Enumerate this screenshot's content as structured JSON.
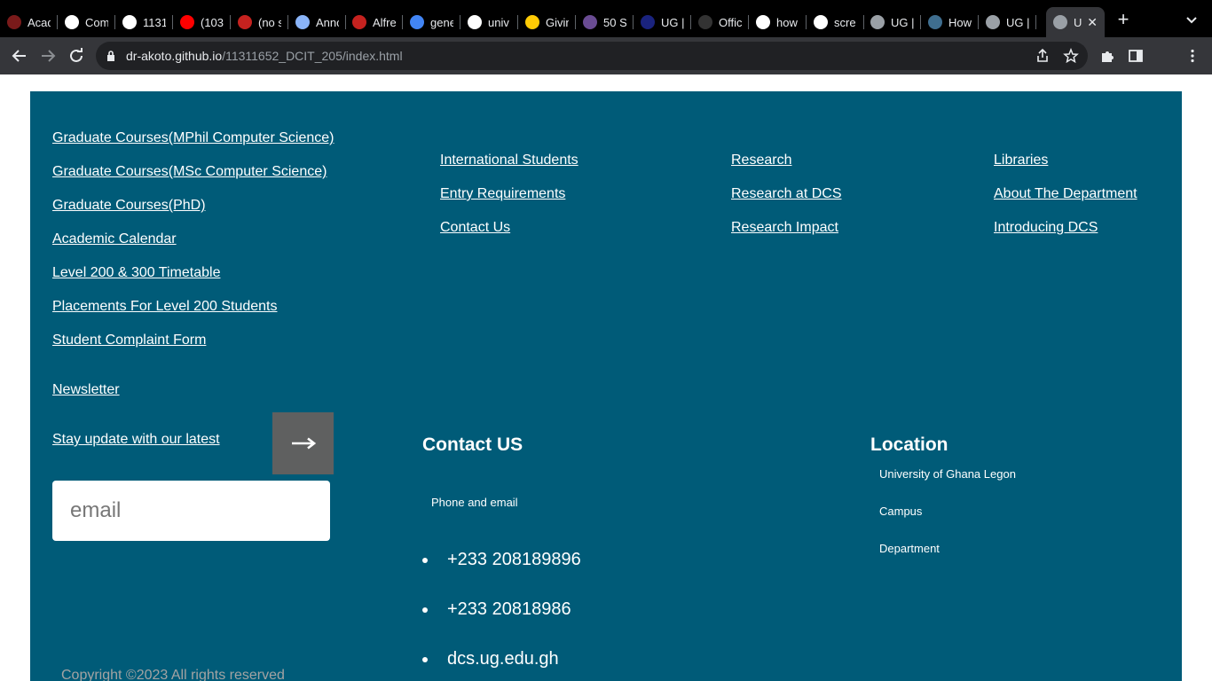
{
  "browser": {
    "tabs": [
      {
        "title": "Acad",
        "favicon": "red-dot-icon",
        "color": "#7a1a1a"
      },
      {
        "title": "Com",
        "favicon": "github-icon",
        "color": "#ffffff"
      },
      {
        "title": "1131",
        "favicon": "github-icon",
        "color": "#ffffff"
      },
      {
        "title": "(103",
        "favicon": "youtube-icon",
        "color": "#ff0000"
      },
      {
        "title": "(no s",
        "favicon": "gmail-icon",
        "color": "#c5221f"
      },
      {
        "title": "Anno",
        "favicon": "doc-icon",
        "color": "#8ab4f8"
      },
      {
        "title": "Alfre",
        "favicon": "gmail-icon",
        "color": "#c5221f"
      },
      {
        "title": "gene",
        "favicon": "search-icon",
        "color": "#4285f4"
      },
      {
        "title": "univ",
        "favicon": "google-icon",
        "color": "#ffffff"
      },
      {
        "title": "Givin",
        "favicon": "michigan-icon",
        "color": "#ffcb05"
      },
      {
        "title": "50 S",
        "favicon": "crest-icon",
        "color": "#6a4c93"
      },
      {
        "title": "UG |",
        "favicon": "ug-icon",
        "color": "#1a237e"
      },
      {
        "title": "Offic",
        "favicon": "github-icon",
        "color": "#333333"
      },
      {
        "title": "how",
        "favicon": "google-icon",
        "color": "#ffffff"
      },
      {
        "title": "scre",
        "favicon": "google-icon",
        "color": "#ffffff"
      },
      {
        "title": "UG |",
        "favicon": "globe-icon",
        "color": "#9aa0a6"
      },
      {
        "title": "How",
        "favicon": "box-icon",
        "color": "#3f6e8f"
      },
      {
        "title": "UG |",
        "favicon": "globe-icon",
        "color": "#9aa0a6"
      },
      {
        "title": "U",
        "favicon": "globe-icon",
        "color": "#9aa0a6",
        "active": true
      }
    ],
    "url_host": "dr-akoto.github.io",
    "url_path": "/11311652_DCIT_205/index.html"
  },
  "footer": {
    "col1_links": [
      "Graduate Courses(MPhil Computer Science)",
      "Graduate Courses(MSc Computer Science)",
      "Graduate Courses(PhD)",
      "Academic Calendar",
      "Level 200 & 300 Timetable",
      "Placements For Level 200 Students",
      "Student Complaint Form"
    ],
    "col2_links": [
      "International Students",
      "Entry Requirements",
      "Contact Us"
    ],
    "col3_links": [
      "Research",
      "Research at DCS",
      "Research Impact"
    ],
    "col4_links": [
      "Libraries",
      "About The Department",
      "Introducing DCS"
    ],
    "newsletter": {
      "title": "Newsletter",
      "subtitle": "Stay update with our latest",
      "email_placeholder": "email",
      "submit_icon": "arrow-right-icon"
    },
    "contact": {
      "heading": "Contact US",
      "subheading": "Phone and email",
      "items": [
        "+233 208189896",
        "+233 20818986",
        "dcs.ug.edu.gh"
      ]
    },
    "location": {
      "heading": "Location",
      "lines": [
        "University of Ghana Legon",
        "Campus",
        "Department"
      ]
    },
    "copyright": "Copyright ©2023 All rights reserved"
  },
  "colors": {
    "footer_bg": "#005b78",
    "submit_bg": "#5f6060"
  }
}
